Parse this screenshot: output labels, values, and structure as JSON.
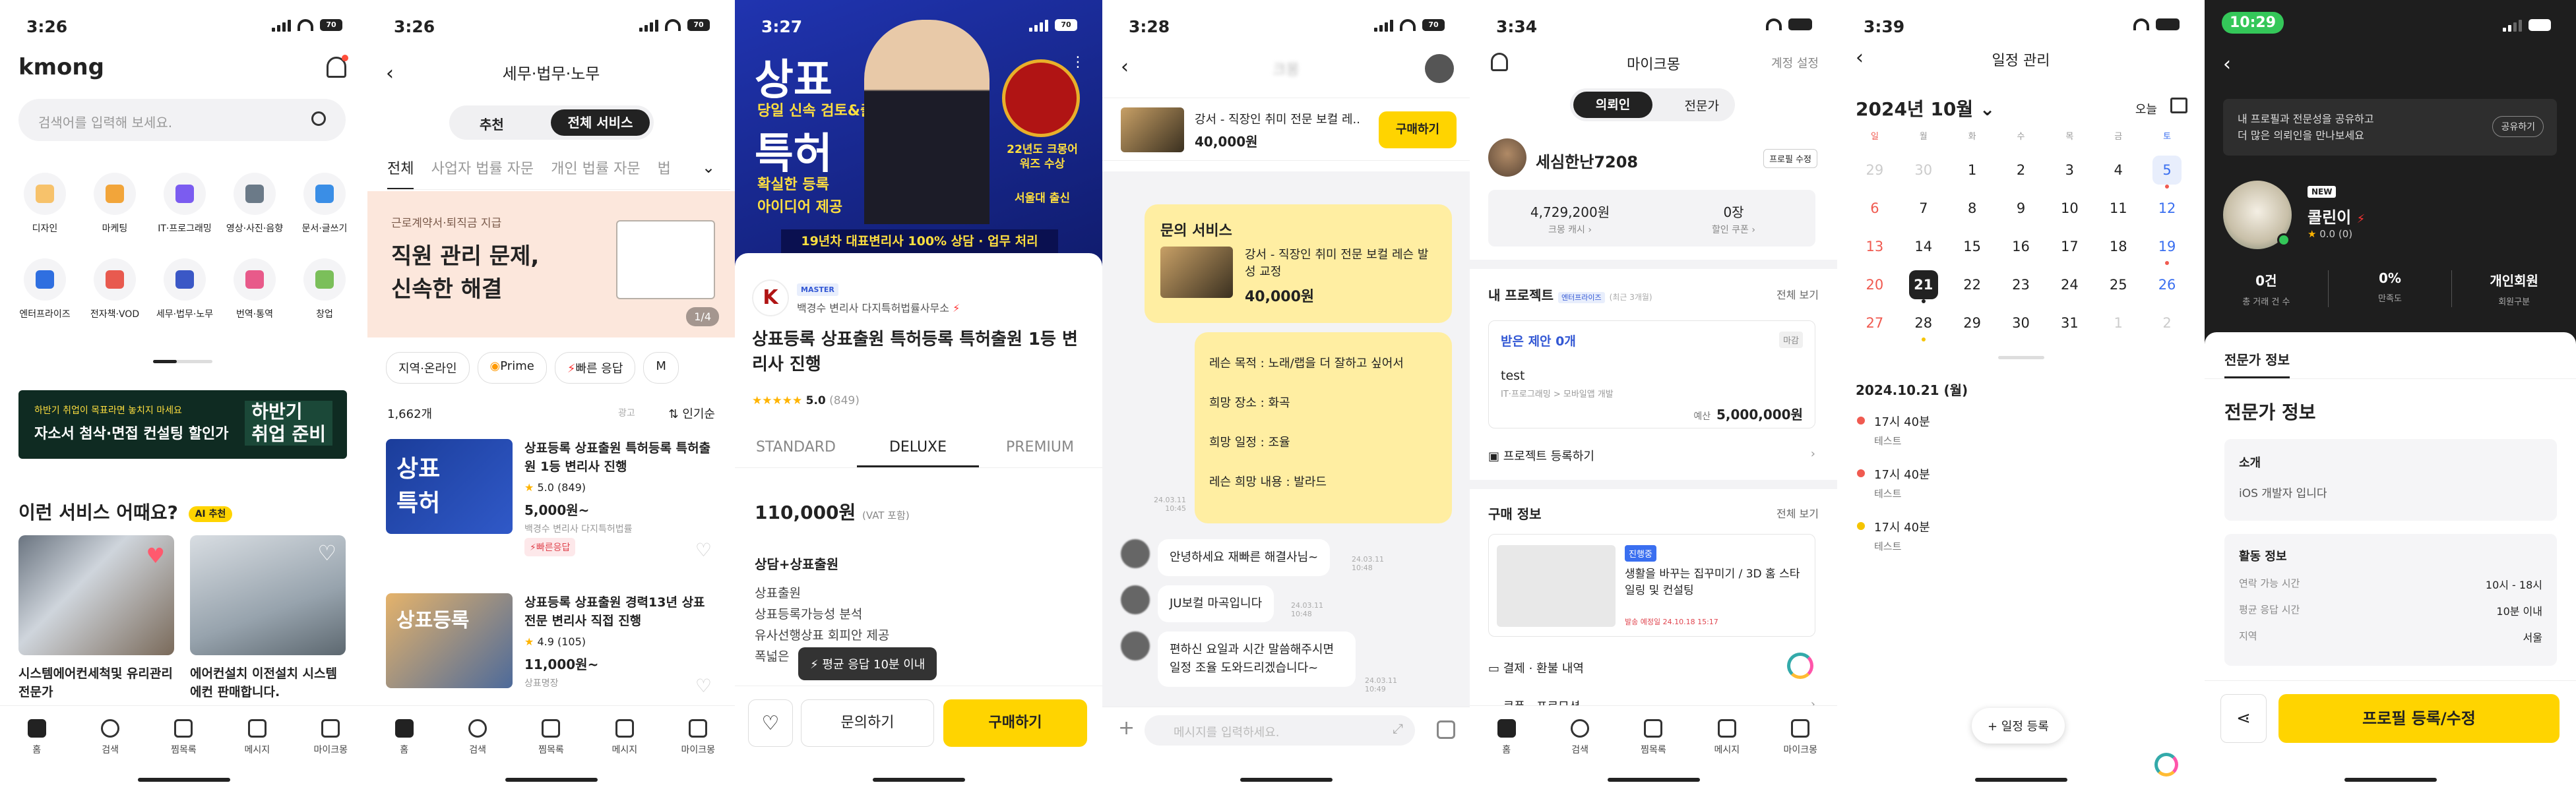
{
  "s1": {
    "time": "3:26",
    "battery": "70",
    "logo": "kmong",
    "search_placeholder": "검색어를 입력해 보세요.",
    "categories": [
      "디자인",
      "마케팅",
      "IT·프로그래밍",
      "영상·사진·음향",
      "문서·글쓰기",
      "엔터프라이즈",
      "전자책·VOD",
      "세무·법무·노무",
      "번역·통역",
      "창업"
    ],
    "banner_small": "하반기 취업이 목표라면 놓치지 마세요",
    "banner_main": "자소서 첨삭·면접 컨설팅 할인가",
    "banner_cta": "하반기\n취업 준비",
    "section_title": "이런 서비스 어때요?",
    "ai_badge": "AI 추천",
    "cards": [
      "시스템에어컨세척및 유리관리전문가",
      "에어컨설치 이전설치 시스템에컨 판매합니다."
    ],
    "tabs": [
      "홈",
      "검색",
      "찜목록",
      "메시지",
      "마이크몽"
    ]
  },
  "s2": {
    "time": "3:26",
    "battery": "70",
    "title": "세무·법무·노무",
    "toggle": [
      "추천",
      "전체 서비스"
    ],
    "subtabs": [
      "전체",
      "사업자 법률 자문",
      "개인 법률 자문",
      "법"
    ],
    "banner_tag": "근로계약서·퇴직금 지급",
    "banner_title": "직원 관리 문제,\n신속한 해결",
    "banner_page": "1/4",
    "filters": [
      "지역·온라인",
      "Prime",
      "빠른 응답",
      "M"
    ],
    "count": "1,662개",
    "ad": "광고",
    "sort": "인기순",
    "items": [
      {
        "title": "상표등록 상표출원 특허등록 특허출원 1등 변리사 진행",
        "rating": "5.0 (849)",
        "price": "5,000원~",
        "seller": "백경수 변리사 다지특허법률",
        "badge": "빠른응답"
      },
      {
        "title": "상표등록 상표출원 경력13년 상표전문 변리사 직접 진행",
        "rating": "4.9 (105)",
        "price": "11,000원~",
        "seller": "상표명장"
      }
    ],
    "tabs": [
      "홈",
      "검색",
      "찜목록",
      "메시지",
      "마이크몽"
    ]
  },
  "s3": {
    "time": "3:27",
    "battery": "70",
    "hero_lines": [
      "상표",
      "당일 신속 검토&출원",
      "특허",
      "확실한 등록",
      "아이디어 제공"
    ],
    "hero_bar": "19년차 대표변리사 100% 상담 · 업무 처리",
    "hero_badge": "22년도 크몽어워즈 수상",
    "hero_badge2": "서울대 출신",
    "master": "MASTER",
    "seller": "백경수 변리사 다지특허법률사무소",
    "title": "상표등록 상표출원 특허등록 특허출원 1등 변리사 진행",
    "rating": "5.0",
    "reviews": "(849)",
    "plans": [
      "STANDARD",
      "DELUXE",
      "PREMIUM"
    ],
    "price": "110,000원",
    "vat": "(VAT 포함)",
    "pkg_title": "상담+상표출원",
    "pkg_items": [
      "상표출원",
      "상표등록가능성 분석",
      "유사선행상표 회피안 제공",
      "폭넓은"
    ],
    "tooltip": "평균 응답 10분 이내",
    "ask": "문의하기",
    "buy": "구매하기"
  },
  "s4": {
    "time": "3:28",
    "battery": "70",
    "name": "크몽",
    "product": "강서 - 직장인 취미 전문 보컬 레...",
    "product_price": "40,000원",
    "buy": "구매하기",
    "inquiry_title": "문의 서비스",
    "inquiry_product": "강서 - 직장인 취미 전문 보컬 레슨 발성 교정",
    "inquiry_price": "40,000원",
    "lesson": [
      "레슨 목적 : 노래/랩을 더 잘하고 싶어서",
      "희망 장소 : 화곡",
      "희망 일정 : 조율",
      "레슨 희망 내용 : 발라드"
    ],
    "sent_time": "24.03.11\n10:45",
    "msgs": [
      {
        "text": "안녕하세요 재빠른 해결사님~",
        "time": "24.03.11\n10:48"
      },
      {
        "text": "JU보컬 마곡입니다",
        "time": "24.03.11\n10:48"
      },
      {
        "text": "편하신 요일과 시간 말씀해주시면 일정 조율 도와드리겠습니다~",
        "time": "24.03.11\n10:49"
      }
    ],
    "input_placeholder": "메시지를 입력하세요."
  },
  "s5": {
    "time": "3:34",
    "title": "마이크몽",
    "settings": "계정 설정",
    "toggle": [
      "의뢰인",
      "전문가"
    ],
    "username": "세심한난7208",
    "edit": "프로필 수정",
    "cash": "4,729,200원",
    "cash_label": "크몽 캐시",
    "coupon": "0장",
    "coupon_label": "할인 쿠폰",
    "projects": "내 프로젝트",
    "enterprise": "엔터프라이즈",
    "recent": "(최근 3개월)",
    "view_all": "전체 보기",
    "proposal": "받은 제안 0개",
    "closed": "마감",
    "project_name": "test",
    "project_cat": "IT·프로그래밍 > 모바일앱 개발",
    "budget_label": "예산",
    "budget": "5,000,000원",
    "register": "프로젝트 등록하기",
    "purchase": "구매 정보",
    "status": "진행중",
    "purchase_title": "생활을 바꾸는 집꾸미기 / 3D 홈 스타일링 및 컨설팅",
    "deadline": "발송 예정일 24.10.18 15:17",
    "menu": [
      "결제 · 환불 내역",
      "쿠폰 · 프로모션"
    ],
    "tabs": [
      "홈",
      "검색",
      "찜목록",
      "메시지",
      "마이크몽"
    ]
  },
  "s6": {
    "time": "3:39",
    "title": "일정 관리",
    "month": "2024년 10월",
    "today": "오늘",
    "weekdays": [
      "일",
      "월",
      "화",
      "수",
      "목",
      "금",
      "토"
    ],
    "days": [
      "29",
      "30",
      "1",
      "2",
      "3",
      "4",
      "5",
      "6",
      "7",
      "8",
      "9",
      "10",
      "11",
      "12",
      "13",
      "14",
      "15",
      "16",
      "17",
      "18",
      "19",
      "20",
      "21",
      "22",
      "23",
      "24",
      "25",
      "26",
      "27",
      "28",
      "29",
      "30",
      "31",
      "1",
      "2"
    ],
    "selected_date": "2024.10.21 (월)",
    "events": [
      {
        "time": "17시 40분",
        "label": "테스트",
        "color": "#f05a50"
      },
      {
        "time": "17시 40분",
        "label": "테스트",
        "color": "#f05a50"
      },
      {
        "time": "17시 40분",
        "label": "테스트",
        "color": "#f5c400"
      }
    ],
    "add": "+ 일정 등록"
  },
  "s7": {
    "time": "10:29",
    "share_text": "내 프로필과 전문성을 공유하고\n더 많은 의뢰인을 만나보세요",
    "share": "공유하기",
    "new": "NEW",
    "name": "콜린이",
    "rating": "0.0 (0)",
    "stats": [
      {
        "v": "0건",
        "l": "총 거래 건 수"
      },
      {
        "v": "0%",
        "l": "만족도"
      },
      {
        "v": "개인회원",
        "l": "회원구분"
      }
    ],
    "tab": "전문가 정보",
    "heading": "전문가 정보",
    "intro_label": "소개",
    "intro": "iOS 개발자 입니다",
    "activity_label": "활동 정보",
    "rows": [
      {
        "k": "연락 가능 시간",
        "v": "10시 - 18시"
      },
      {
        "k": "평균 응답 시간",
        "v": "10분 이내"
      },
      {
        "k": "지역",
        "v": "서울"
      }
    ],
    "cta": "프로필 등록/수정"
  }
}
